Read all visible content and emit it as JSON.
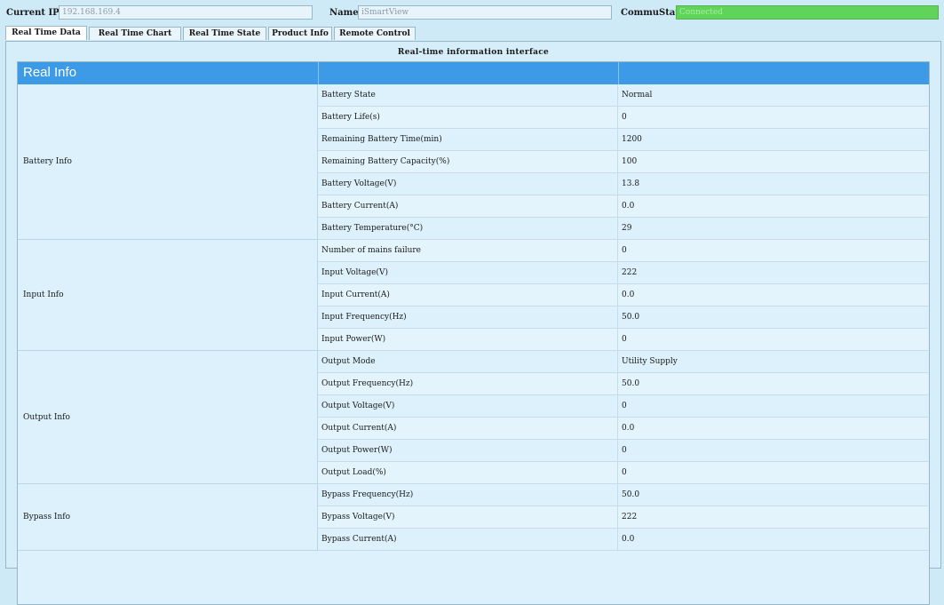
{
  "topbar": {
    "current_ip_label": "Current IP:",
    "current_ip_value": "192.168.169.4",
    "name_label": "Name:",
    "name_value": "iSmartView",
    "commu_label": "CommuState:",
    "commu_value": "Connected"
  },
  "tabs": [
    "Real Time Data",
    "Real Time Chart",
    "Real Time State",
    "Product Info",
    "Remote Control"
  ],
  "caption": "Real-time information interface",
  "grid": {
    "header_title": "Real Info",
    "groups": [
      {
        "name": "Battery Info",
        "rows": [
          {
            "name": "Battery State",
            "value": "Normal"
          },
          {
            "name": "Battery Life(s)",
            "value": "0"
          },
          {
            "name": "Remaining Battery Time(min)",
            "value": "1200"
          },
          {
            "name": "Remaining Battery Capacity(%)",
            "value": "100"
          },
          {
            "name": "Battery Voltage(V)",
            "value": "13.8"
          },
          {
            "name": "Battery Current(A)",
            "value": "0.0"
          },
          {
            "name": "Battery Temperature(°C)",
            "value": "29"
          }
        ]
      },
      {
        "name": "Input Info",
        "rows": [
          {
            "name": "Number of mains failure",
            "value": "0"
          },
          {
            "name": "Input Voltage(V)",
            "value": "222"
          },
          {
            "name": "Input Current(A)",
            "value": "0.0"
          },
          {
            "name": "Input Frequency(Hz)",
            "value": "50.0"
          },
          {
            "name": "Input Power(W)",
            "value": "0"
          }
        ]
      },
      {
        "name": "Output Info",
        "rows": [
          {
            "name": "Output Mode",
            "value": "Utility Supply"
          },
          {
            "name": "Output Frequency(Hz)",
            "value": "50.0"
          },
          {
            "name": "Output Voltage(V)",
            "value": "0"
          },
          {
            "name": "Output Current(A)",
            "value": "0.0"
          },
          {
            "name": "Output Power(W)",
            "value": "0"
          },
          {
            "name": "Output Load(%)",
            "value": "0"
          }
        ]
      },
      {
        "name": "Bypass Info",
        "rows": [
          {
            "name": "Bypass Frequency(Hz)",
            "value": "50.0"
          },
          {
            "name": "Bypass Voltage(V)",
            "value": "222"
          },
          {
            "name": "Bypass Current(A)",
            "value": "0.0"
          }
        ]
      }
    ]
  },
  "icons": {
    "scroll_up": "arrow-up-icon",
    "scroll_down": "arrow-down-icon"
  },
  "colors": {
    "header_blue": "#3d9ae6",
    "connected_green": "#5fd35a",
    "background": "#cfeaf7"
  }
}
